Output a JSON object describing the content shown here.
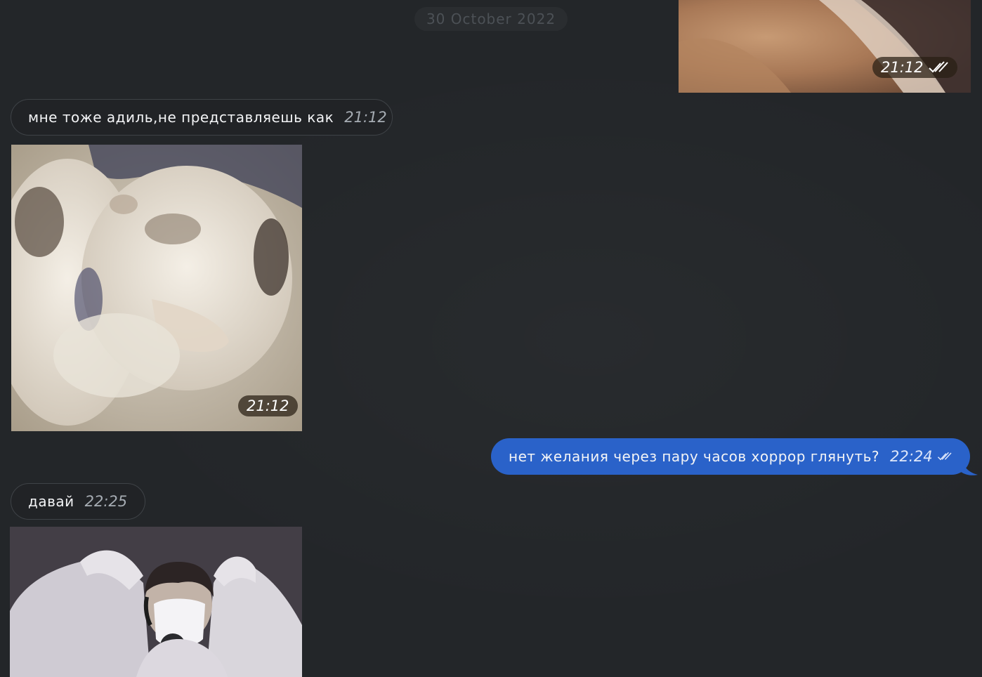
{
  "date_separator": "30 October 2022",
  "messages": [
    {
      "type": "photo",
      "direction": "out",
      "time": "21:12",
      "read": true,
      "image": "kitten-fur-photo"
    },
    {
      "type": "text",
      "direction": "in",
      "text": "мне тоже адиль,не представляешь как",
      "time": "21:12"
    },
    {
      "type": "photo",
      "direction": "in",
      "time": "21:12",
      "image": "kittens-kissing-photo"
    },
    {
      "type": "text",
      "direction": "out",
      "text": "нет желания через пару часов хоррор глянуть?",
      "time": "22:24",
      "read": true
    },
    {
      "type": "text",
      "direction": "in",
      "text": "давай",
      "time": "22:25"
    },
    {
      "type": "photo",
      "direction": "in",
      "time": "",
      "image": "person-with-microphone-photo"
    }
  ],
  "colors": {
    "background": "#232629",
    "outgoing_bubble": "#2a62c9",
    "incoming_bubble": "#212326",
    "incoming_border": "#3f4347",
    "meta_text": "#a6acb3"
  },
  "icons": {
    "read_receipt": "double-check-icon",
    "bubble_tail": "bubble-tail-icon"
  }
}
